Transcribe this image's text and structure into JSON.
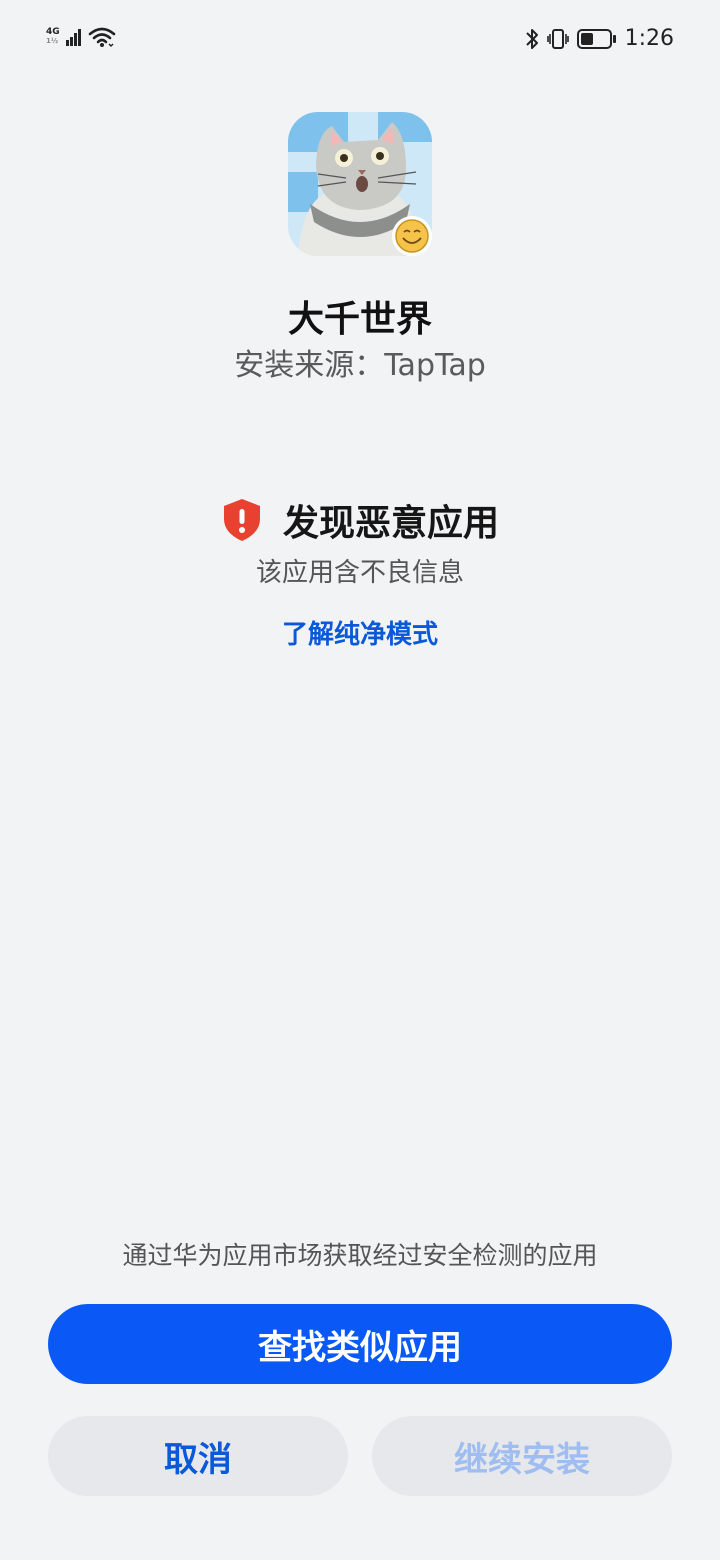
{
  "status_bar": {
    "network_label": "4G",
    "network_sub": "1½",
    "time": "1:26"
  },
  "app": {
    "name": "大千世界",
    "source": "安装来源：TapTap"
  },
  "warning": {
    "title": "发现恶意应用",
    "description": "该应用含不良信息",
    "learn_more": "了解纯净模式",
    "color": "#e8412f"
  },
  "footer": {
    "hint": "通过华为应用市场获取经过安全检测的应用",
    "primary_button": "查找类似应用",
    "cancel_button": "取消",
    "continue_button": "继续安装"
  },
  "colors": {
    "accent": "#0a59f7",
    "link": "#0a59d8",
    "background": "#f1f3f5"
  }
}
